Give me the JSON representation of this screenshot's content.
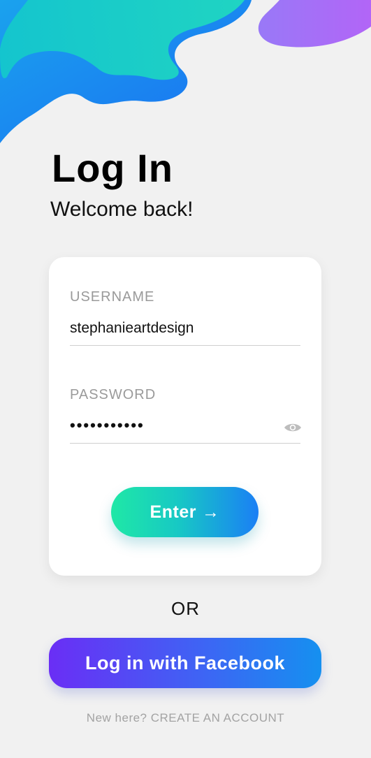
{
  "header": {
    "title": "Log In",
    "subtitle": "Welcome back!"
  },
  "form": {
    "username": {
      "label": "USERNAME",
      "value": "stephanieartdesign"
    },
    "password": {
      "label": "PASSWORD",
      "value": "•••••••••••",
      "toggle_icon": "eye-icon"
    },
    "enter_button": {
      "label": "Enter",
      "arrow": "→"
    }
  },
  "divider": {
    "text": "OR"
  },
  "facebook_button": {
    "label": "Log in with Facebook"
  },
  "signup": {
    "prompt": "New here?",
    "link": "CREATE AN ACCOUNT"
  },
  "colors": {
    "background": "#f1f1f1",
    "enter_gradient_start": "#1fe8a6",
    "enter_gradient_end": "#1a7ff5",
    "facebook_gradient_start": "#6a2ef5",
    "facebook_gradient_end": "#1590f0",
    "wave_purple": "#b265f7",
    "wave_teal": "#17d0c6",
    "wave_blue": "#1a8bf0"
  }
}
